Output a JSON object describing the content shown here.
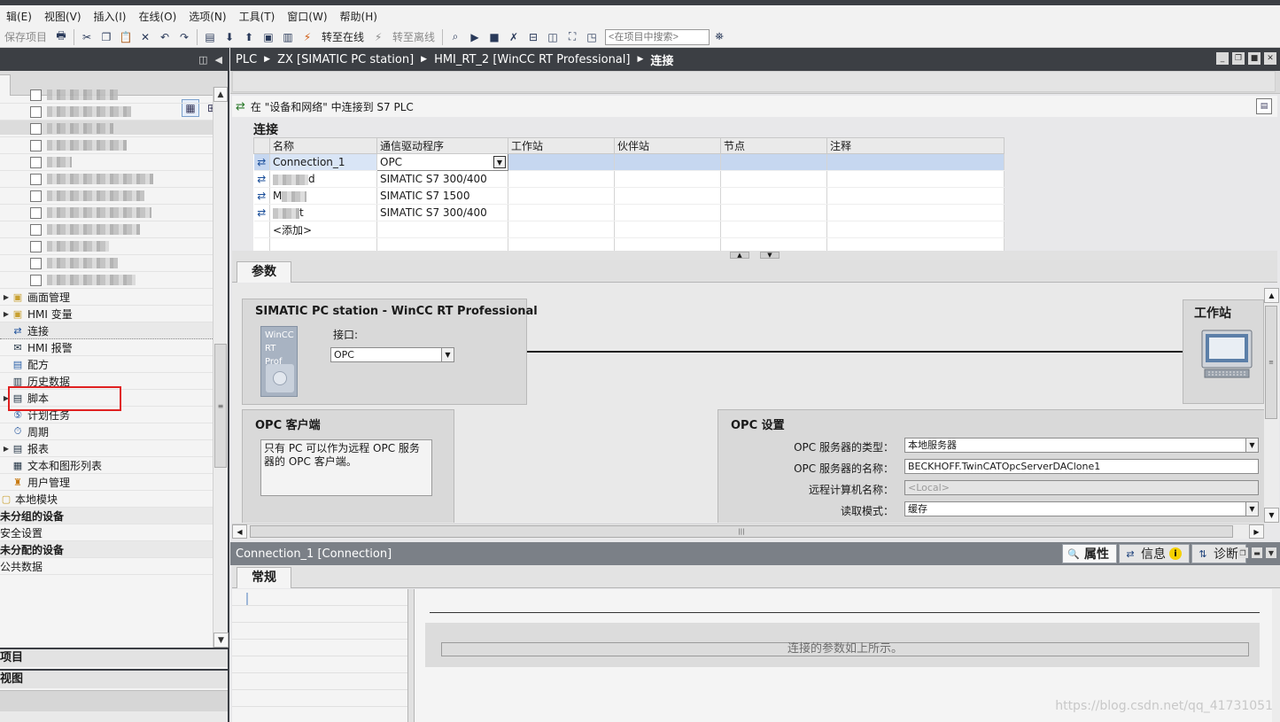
{
  "menu": [
    "编辑(E)",
    "视图(V)",
    "插入(I)",
    "在线(O)",
    "选项(N)",
    "工具(T)",
    "窗口(W)",
    "帮助(H)"
  ],
  "menu_display": [
    "辑(E)",
    "视图(V)",
    "插入(I)",
    "在线(O)",
    "选项(N)",
    "工具(T)",
    "窗口(W)",
    "帮助(H)"
  ],
  "toolbar": {
    "save_project": "保存项目",
    "go_online": "转至在线",
    "go_offline": "转至离线",
    "search_placeholder": "<在项目中搜索>"
  },
  "tree": {
    "checkbox_items": [
      {
        "label": "生",
        "blurred": true
      },
      {
        "label": "",
        "blurred": true
      },
      {
        "label": "生",
        "blurred": true
      },
      {
        "label": "状态",
        "blurred": true
      },
      {
        "label": "设",
        "blurred": true
      },
      {
        "label": "",
        "blurred": true
      },
      {
        "label": "",
        "blurred": true
      },
      {
        "label": "2",
        "blurred": true
      },
      {
        "label": "",
        "blurred": true
      },
      {
        "label": "",
        "blurred": true
      },
      {
        "label": "设",
        "blurred": true
      },
      {
        "label": "",
        "blurred": true
      }
    ],
    "items": [
      {
        "label": "画面管理",
        "expander": true,
        "icon": "folder-screens-icon"
      },
      {
        "label": "HMI 变量",
        "expander": true,
        "icon": "folder-tags-icon"
      },
      {
        "label": "连接",
        "expander": false,
        "icon": "connection-icon",
        "selected": true
      },
      {
        "label": "HMI 报警",
        "expander": false,
        "icon": "alarm-icon"
      },
      {
        "label": "配方",
        "expander": false,
        "icon": "recipe-icon"
      },
      {
        "label": "历史数据",
        "expander": false,
        "icon": "archive-icon"
      },
      {
        "label": "脚本",
        "expander": true,
        "icon": "script-icon"
      },
      {
        "label": "计划任务",
        "expander": false,
        "icon": "scheduler-icon"
      },
      {
        "label": "周期",
        "expander": false,
        "icon": "cycle-icon"
      },
      {
        "label": "报表",
        "expander": true,
        "icon": "report-icon"
      },
      {
        "label": "文本和图形列表",
        "expander": false,
        "icon": "textlist-icon"
      },
      {
        "label": "用户管理",
        "expander": false,
        "icon": "user-admin-icon"
      }
    ],
    "root_items": [
      {
        "label": "本地模块",
        "bold": false
      },
      {
        "label": "未分组的设备",
        "bold": true
      },
      {
        "label": "安全设置",
        "bold": false
      },
      {
        "label": "未分配的设备",
        "bold": true
      },
      {
        "label": "公共数据",
        "bold": false
      }
    ]
  },
  "left_bars": [
    "项目",
    "视图"
  ],
  "left_bars_display": [
    "项目",
    "视图"
  ],
  "breadcrumb": [
    "PLC",
    "ZX [SIMATIC PC station]",
    "HMI_RT_2 [WinCC RT Professional]",
    "连接"
  ],
  "editor": {
    "info_text": "在 \"设备和网络\" 中连接到 S7 PLC",
    "section_title": "连接",
    "columns": [
      "名称",
      "通信驱动程序",
      "工作站",
      "伙伴站",
      "节点",
      "注释"
    ],
    "rows": [
      {
        "name": "Connection_1",
        "driver": "OPC",
        "selected": true,
        "blurred": false
      },
      {
        "name": "d",
        "driver": "SIMATIC S7 300/400",
        "selected": false,
        "blurred": true
      },
      {
        "name": "M",
        "driver": "SIMATIC S7 1500",
        "selected": false,
        "blurred": true
      },
      {
        "name": "t",
        "driver": "SIMATIC S7 300/400",
        "selected": false,
        "blurred": true
      }
    ],
    "add_row": "<添加>"
  },
  "params": {
    "tab": "参数",
    "station_title": "SIMATIC PC station - WinCC RT Professional",
    "card_line1": "WinCC",
    "card_line2": "RT Prof",
    "interface_label": "接口:",
    "interface_value": "OPC",
    "workstation_title": "工作站",
    "opc_client_title": "OPC 客户端",
    "opc_client_text": "只有 PC 可以作为远程 OPC 服务器的 OPC 客户端。",
    "opc_settings_title": "OPC 设置",
    "server_type_label": "OPC 服务器的类型：",
    "server_type_value": "本地服务器",
    "server_name_label": "OPC 服务器的名称：",
    "server_name_value": "BECKHOFF.TwinCATOpcServerDAClone1",
    "remote_pc_label": "远程计算机名称：",
    "remote_pc_value": "<Local>",
    "read_mode_label": "读取模式：",
    "read_mode_value": "缓存"
  },
  "inspector": {
    "title": "Connection_1 [Connection]",
    "tabs": [
      "属性",
      "信息",
      "诊断"
    ],
    "general_tab": "常规",
    "message": "连接的参数如上所示。"
  },
  "watermark": "https://blog.csdn.net/qq_41731051"
}
